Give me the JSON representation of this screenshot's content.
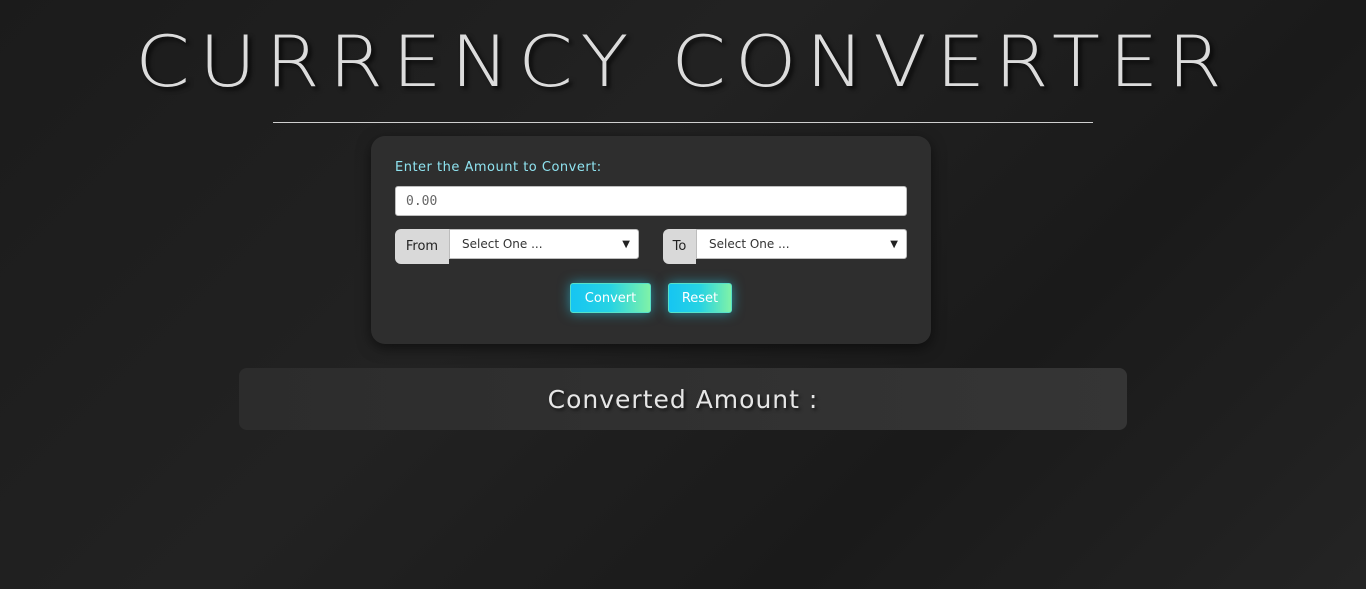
{
  "header": {
    "title": "CURRENCY CONVERTER"
  },
  "form": {
    "amount_label": "Enter the Amount to Convert:",
    "amount_placeholder": "0.00",
    "from": {
      "label": "From",
      "selected": "Select One ..."
    },
    "to": {
      "label": "To",
      "selected": "Select One ..."
    },
    "convert_label": "Convert",
    "reset_label": "Reset"
  },
  "result": {
    "label": "Converted Amount :"
  },
  "colors": {
    "background": "#1e1e1e",
    "card": "#2e2e2e",
    "accent_label": "#8fe3f0",
    "button_gradient_start": "#16c5f2",
    "button_gradient_end": "#7ff2a8"
  },
  "icons": {
    "select_arrow": "chevron-down-icon"
  }
}
